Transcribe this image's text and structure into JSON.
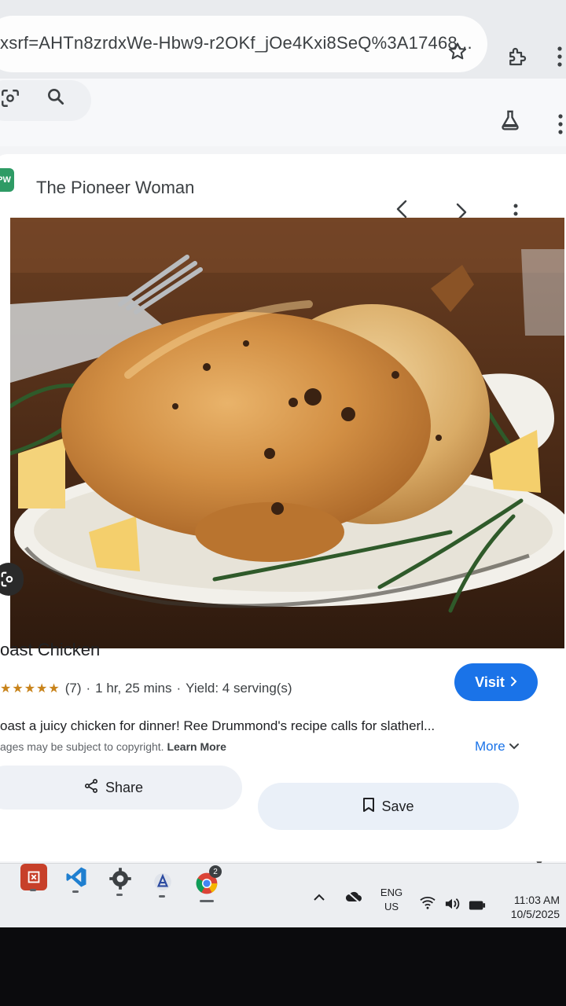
{
  "browser": {
    "url_text": "xsrf=AHTn8zrdxWe-Hbw9-r2OKf_jOe4Kxi8SeQ%3A17468..."
  },
  "panel": {
    "source_name": "The Pioneer Woman",
    "favicon_text": "PW",
    "title": "oast Chicken",
    "visit_label": "Visit",
    "rating_stars": "★★★★★",
    "rating_count": "(7)",
    "sep1": "·",
    "duration": "1 hr, 25 mins",
    "sep2": "·",
    "yield": "Yield: 4 serving(s)",
    "description": "oast a juicy chicken for dinner! Ree Drummond's recipe calls for slatherl...",
    "more_label": "More",
    "copyright": "ages may be subject to copyright.",
    "learn_more": "Learn More",
    "share_label": "Share",
    "save_label": "Save"
  },
  "taskbar": {
    "lang_top": "ENG",
    "lang_bottom": "US",
    "time": "11:03 AM",
    "date": "10/5/2025",
    "chrome_badge": "2"
  },
  "colors": {
    "accent": "#1a73e8",
    "star": "#c8831a"
  }
}
